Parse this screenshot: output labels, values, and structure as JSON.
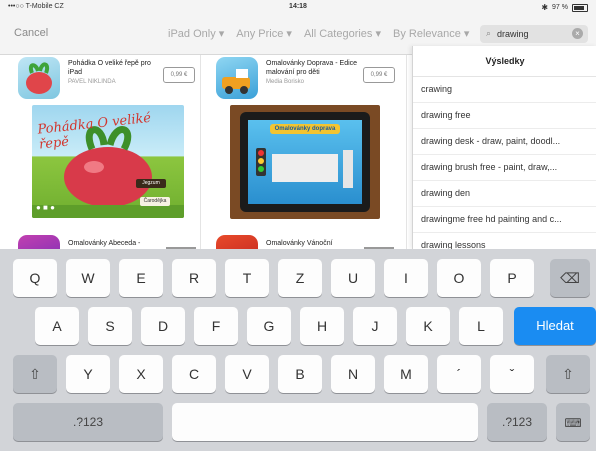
{
  "status": {
    "carrier": "•••○○ T-Mobile CZ",
    "time": "14:18",
    "battery": "97 %"
  },
  "nav": {
    "cancel": "Cancel",
    "filters": [
      "iPad Only",
      "Any Price",
      "All Categories",
      "By Relevance"
    ],
    "search_value": "drawing"
  },
  "apps": [
    {
      "title": "Pohádka O veliké řepě pro iPad",
      "developer": "PAVEL NIKLINDA",
      "price": "0,99 €",
      "shot_title": "Pohádka O veliké řepě",
      "shot_button": "Jegzum",
      "shot_button2": "Čarodějka"
    },
    {
      "title": "Omalovánky Doprava - Edice malování pro děti",
      "developer": "Media Borisko",
      "price": "0,99 €",
      "shot_title": "Omalovánky doprava"
    },
    {
      "title": "Omalovánky Abeceda -"
    },
    {
      "title": "Omalovánky Vánoční"
    }
  ],
  "suggestions": {
    "header": "Výsledky",
    "items": [
      "crawing",
      "drawing free",
      "drawing desk - draw, paint, doodl...",
      "drawing brush free - paint, draw,...",
      "drawing den",
      "drawingme free hd painting and c...",
      "drawing lessons"
    ]
  },
  "keyboard": {
    "row1": [
      "Q",
      "W",
      "E",
      "R",
      "T",
      "Z",
      "U",
      "I",
      "O",
      "P"
    ],
    "row2": [
      "A",
      "S",
      "D",
      "F",
      "G",
      "H",
      "J",
      "K",
      "L"
    ],
    "row3": [
      "Y",
      "X",
      "C",
      "V",
      "B",
      "N",
      "M",
      "´",
      "ˇ"
    ],
    "search_key": "Hledat",
    "numbers": ".?123"
  },
  "colors": {
    "accent": "#1a8cf2"
  }
}
